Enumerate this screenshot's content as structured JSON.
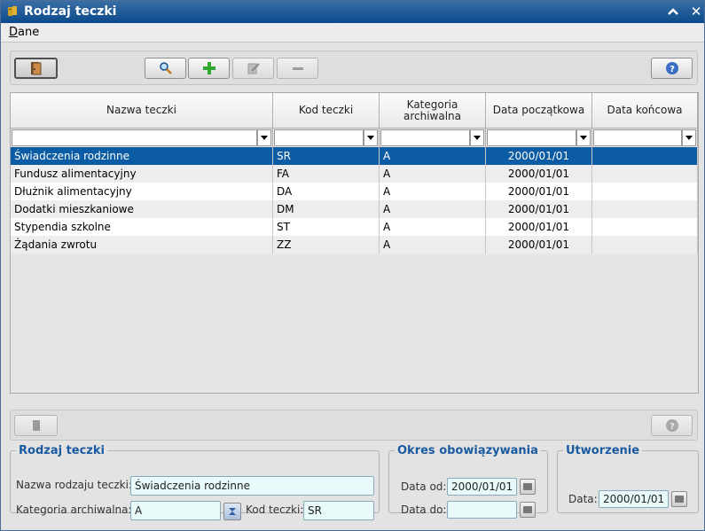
{
  "window": {
    "title": "Rodzaj teczki",
    "minimize_glyph": "^",
    "close_glyph": "✕"
  },
  "menu": {
    "items": [
      {
        "label": "Dane",
        "accel": "D",
        "rest": "ane"
      }
    ]
  },
  "toolbar": {
    "buttons": [
      {
        "name": "exit-button",
        "icon": "door-icon"
      },
      {
        "name": "search-button",
        "icon": "magnifier-icon"
      },
      {
        "name": "add-button",
        "icon": "plus-icon"
      },
      {
        "name": "edit-button",
        "icon": "pencil-icon",
        "disabled": true
      },
      {
        "name": "delete-button",
        "icon": "minus-icon",
        "disabled": true
      },
      {
        "name": "help-button",
        "icon": "question-icon"
      }
    ]
  },
  "grid": {
    "columns": [
      {
        "label": "Nazwa teczki"
      },
      {
        "label": "Kod teczki"
      },
      {
        "label": "Kategoria archiwalna"
      },
      {
        "label": "Data początkowa"
      },
      {
        "label": "Data końcowa"
      }
    ],
    "rows": [
      {
        "name": "Świadczenia rodzinne",
        "code": "SR",
        "category": "A",
        "start": "2000/01/01",
        "end": ""
      },
      {
        "name": "Fundusz alimentacyjny",
        "code": "FA",
        "category": "A",
        "start": "2000/01/01",
        "end": ""
      },
      {
        "name": "Dłużnik alimentacyjny",
        "code": "DA",
        "category": "A",
        "start": "2000/01/01",
        "end": ""
      },
      {
        "name": "Dodatki mieszkaniowe",
        "code": "DM",
        "category": "A",
        "start": "2000/01/01",
        "end": ""
      },
      {
        "name": "Stypendia szkolne",
        "code": "ST",
        "category": "A",
        "start": "2000/01/01",
        "end": ""
      },
      {
        "name": "Żądania zwrotu",
        "code": "ZZ",
        "category": "A",
        "start": "2000/01/01",
        "end": ""
      }
    ],
    "selected_row": 0
  },
  "detail": {
    "rodzaj": {
      "legend": "Rodzaj teczki",
      "name_label": "Nazwa rodzaju teczki:",
      "name_value": "Świadczenia rodzinne",
      "category_label": "Kategoria archiwalna:",
      "category_value": "A",
      "code_label": "Kod teczki:",
      "code_value": "SR"
    },
    "okres": {
      "legend": "Okres obowiązywania",
      "from_label": "Data od:",
      "from_value": "2000/01/01",
      "to_label": "Data do:",
      "to_value": ""
    },
    "utworzenie": {
      "legend": "Utworzenie",
      "date_label": "Data:",
      "date_value": "2000/01/01"
    }
  },
  "colors": {
    "title_bar": "#0b4a8c",
    "selection": "#0b5ca4",
    "legend": "#1a5aa0",
    "field_bg": "#e8fafa"
  }
}
